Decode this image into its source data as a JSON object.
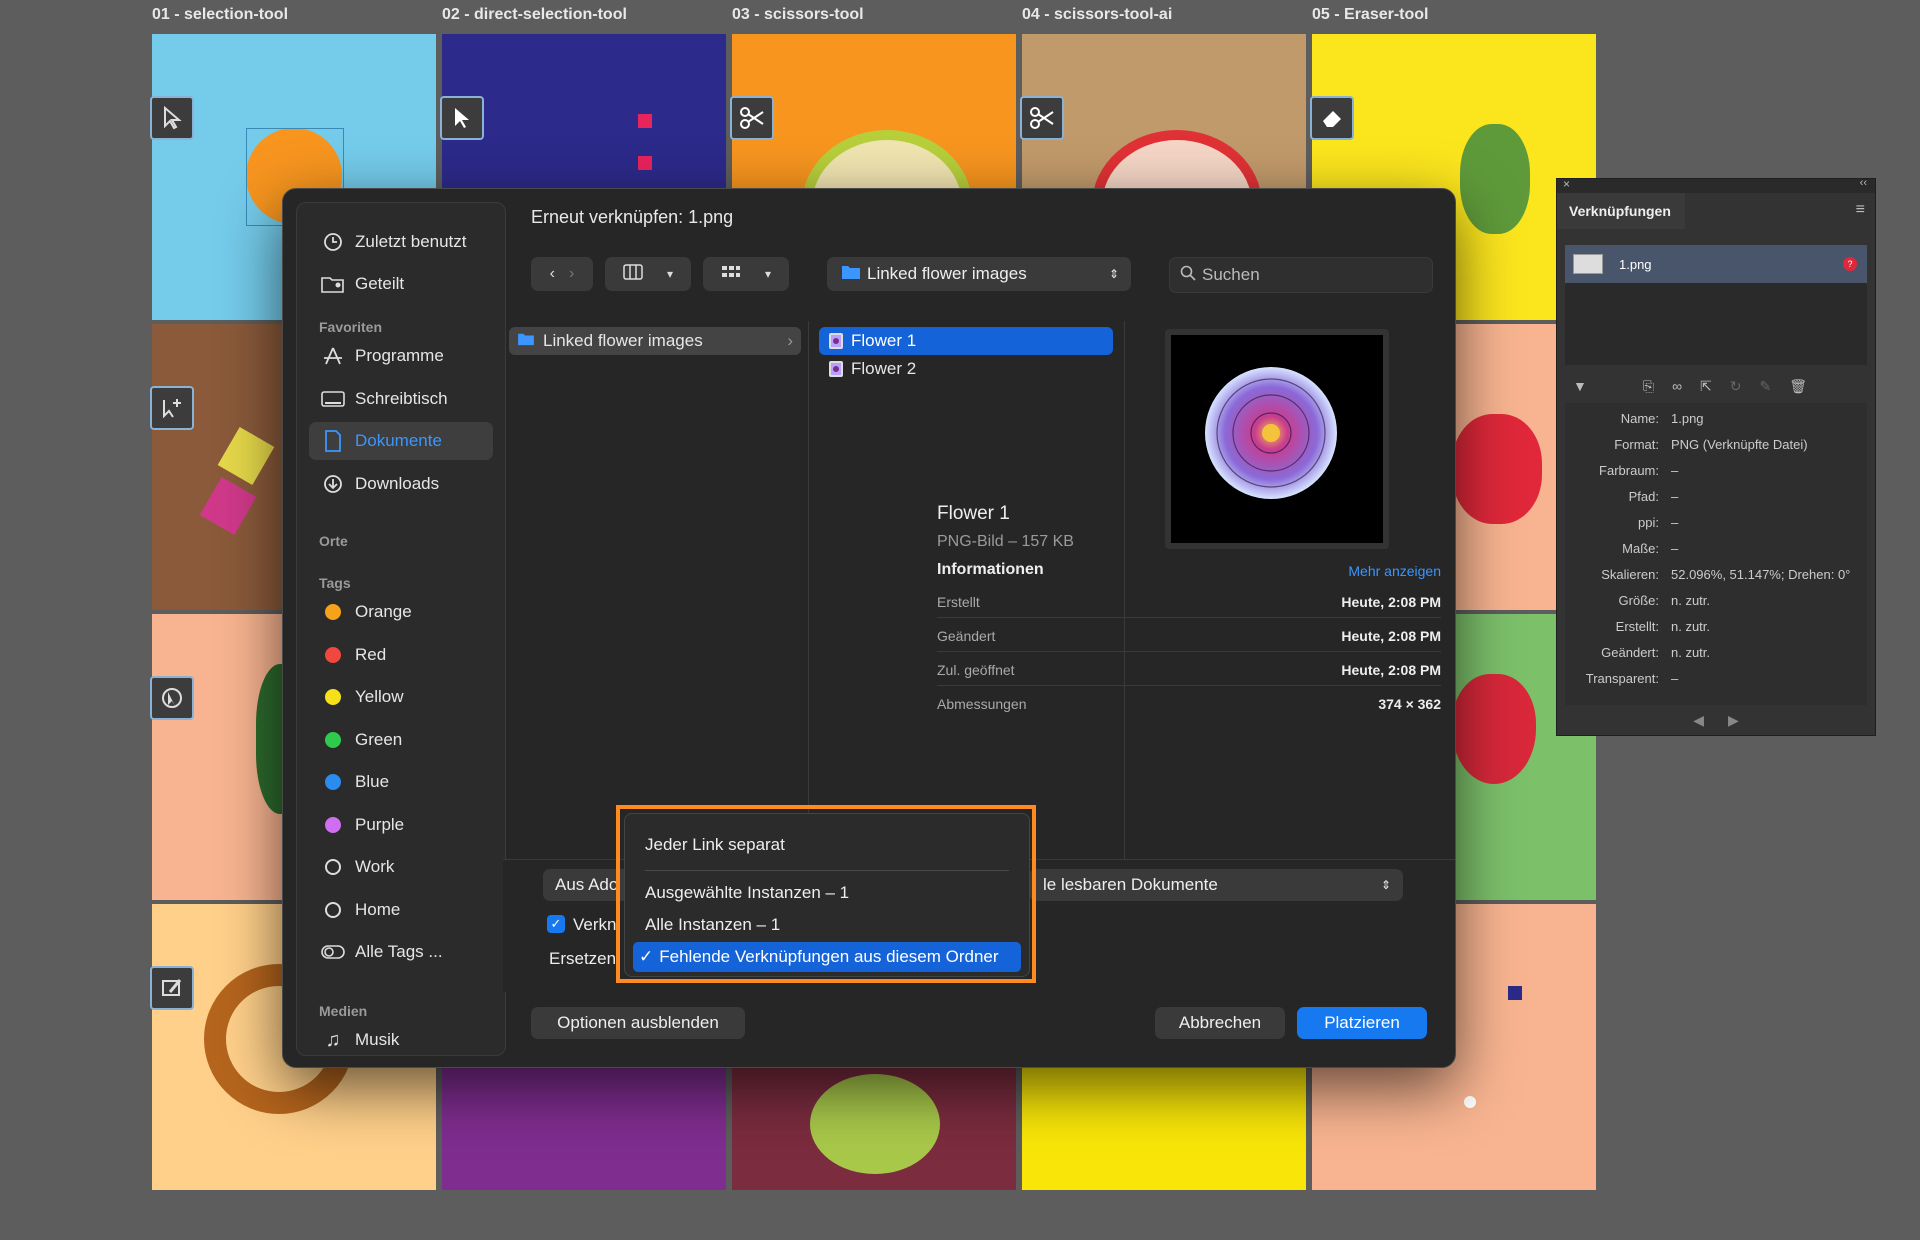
{
  "artboards": {
    "labels": [
      "01 - selection-tool",
      "02 - direct-selection-tool",
      "03 - scissors-tool",
      "04 - scissors-tool-ai",
      "05 - Eraser-tool"
    ],
    "colors": [
      "#74cbea",
      "#2c2a8a",
      "#f7951f",
      "#c19a6b",
      "#fbe51d",
      "#8a5a3a",
      "#f8b490",
      "#7cc06a",
      "#ffd08a",
      "#7f2d8f",
      "#7b2c3e",
      "#f9e608",
      "#f8b490"
    ]
  },
  "dialog": {
    "title": "Erneut verknüpfen: 1.png",
    "sidebar": {
      "recent": "Zuletzt benutzt",
      "shared": "Geteilt",
      "favorites_header": "Favoriten",
      "favorites": [
        "Programme",
        "Schreibtisch",
        "Dokumente",
        "Downloads"
      ],
      "selected": "Dokumente",
      "places_header": "Orte",
      "tags_header": "Tags",
      "tags": [
        {
          "label": "Orange",
          "color": "#f7a21b"
        },
        {
          "label": "Red",
          "color": "#f0483e"
        },
        {
          "label": "Yellow",
          "color": "#f5e01a"
        },
        {
          "label": "Green",
          "color": "#2ecb4d"
        },
        {
          "label": "Blue",
          "color": "#2b8cf0"
        },
        {
          "label": "Purple",
          "color": "#cf6ef0"
        }
      ],
      "tags_plain": [
        "Work",
        "Home",
        "Alle Tags ..."
      ],
      "media_header": "Medien",
      "media": [
        "Musik"
      ]
    },
    "path_popup": "Linked flower images",
    "search_placeholder": "Suchen",
    "column1": [
      "Linked flower images"
    ],
    "column2": [
      "Flower 1",
      "Flower 2"
    ],
    "preview": {
      "name": "Flower 1",
      "kind": "PNG-Bild – 157 KB",
      "info_header": "Informationen",
      "more": "Mehr anzeigen",
      "rows": [
        {
          "k": "Erstellt",
          "v": "Heute, 2:08 PM"
        },
        {
          "k": "Geändert",
          "v": "Heute, 2:08 PM"
        },
        {
          "k": "Zul. geöffnet",
          "v": "Heute, 2:08 PM"
        },
        {
          "k": "Abmessungen",
          "v": "374 × 362"
        }
      ]
    },
    "options": {
      "source_label": "Aus Ado",
      "filter_label": "le lesbaren Dokumente",
      "checkbox_label": "Verkn",
      "replace_label": "Ersetzen"
    },
    "menu": {
      "items": [
        "Jeder Link separat",
        "Ausgewählte Instanzen – 1",
        "Alle Instanzen – 1",
        "Fehlende Verknüpfungen aus diesem Ordner"
      ],
      "selected_index": 3,
      "check": "✓"
    },
    "buttons": {
      "hide_options": "Optionen ausblenden",
      "cancel": "Abbrechen",
      "place": "Platzieren"
    }
  },
  "links_panel": {
    "title": "Verknüpfungen",
    "item": "1.png",
    "fields": [
      {
        "k": "Name:",
        "v": "1.png"
      },
      {
        "k": "Format:",
        "v": "PNG (Verknüpfte Datei)"
      },
      {
        "k": "Farbraum:",
        "v": "–"
      },
      {
        "k": "Pfad:",
        "v": "–"
      },
      {
        "k": "ppi:",
        "v": "–"
      },
      {
        "k": "Maße:",
        "v": "–"
      },
      {
        "k": "Skalieren:",
        "v": "52.096%, 51.147%; Drehen: 0°"
      },
      {
        "k": "Größe:",
        "v": "n. zutr."
      },
      {
        "k": "Erstellt:",
        "v": "n. zutr."
      },
      {
        "k": "Geändert:",
        "v": "n. zutr."
      },
      {
        "k": "Transparent:",
        "v": "–"
      }
    ]
  }
}
